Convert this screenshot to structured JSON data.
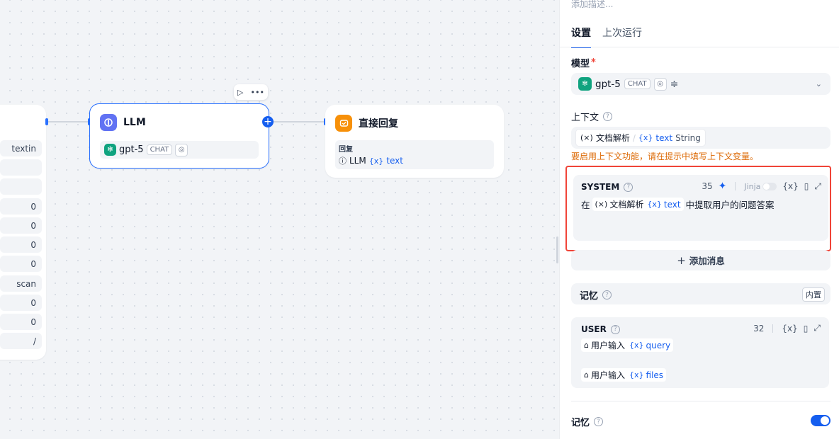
{
  "canvas": {
    "left_node_values": [
      "textin",
      "",
      "",
      "0",
      "0",
      "0",
      "0",
      "scan",
      "0",
      "0",
      "/"
    ],
    "llm_node": {
      "title": "LLM",
      "model": "gpt-5",
      "badge": "CHAT"
    },
    "reply_node": {
      "title": "直接回复",
      "body_label": "回复",
      "source": "LLM",
      "var": "text",
      "var_prefix": "{x}"
    }
  },
  "panel": {
    "description_placeholder": "添加描述...",
    "tabs": [
      "设置",
      "上次运行"
    ],
    "model": {
      "label": "模型",
      "required": "*",
      "value": "gpt-5",
      "badge": "CHAT"
    },
    "context": {
      "label": "上下文",
      "node": "文档解析",
      "separator": "/",
      "var": "text",
      "type": "String",
      "warning": "要启用上下文功能，请在提示中填写上下文变量。"
    },
    "system_prompt": {
      "role": "SYSTEM",
      "count": "35",
      "jinja": "Jinja",
      "var_button": "{x}",
      "text_before": "在",
      "node": "文档解析",
      "var": "text",
      "text_after": "中提取用户的问题答案"
    },
    "add_message": "添加消息",
    "memory": {
      "label": "记忆",
      "badge": "内置"
    },
    "user_prompt": {
      "role": "USER",
      "count": "32",
      "var_button": "{x}",
      "line1_source": "用户输入",
      "line1_var": "query",
      "line2_source": "用户输入",
      "line2_var": "files"
    },
    "memory_toggle": {
      "label": "记忆",
      "enabled": true
    }
  },
  "colors": {
    "accent": "#155eef",
    "warning": "#dc6803",
    "highlight_frame": "#f04438",
    "llm_icon": "#6172f3",
    "reply_icon": "#f79009",
    "gpt_logo": "#10a37f"
  }
}
